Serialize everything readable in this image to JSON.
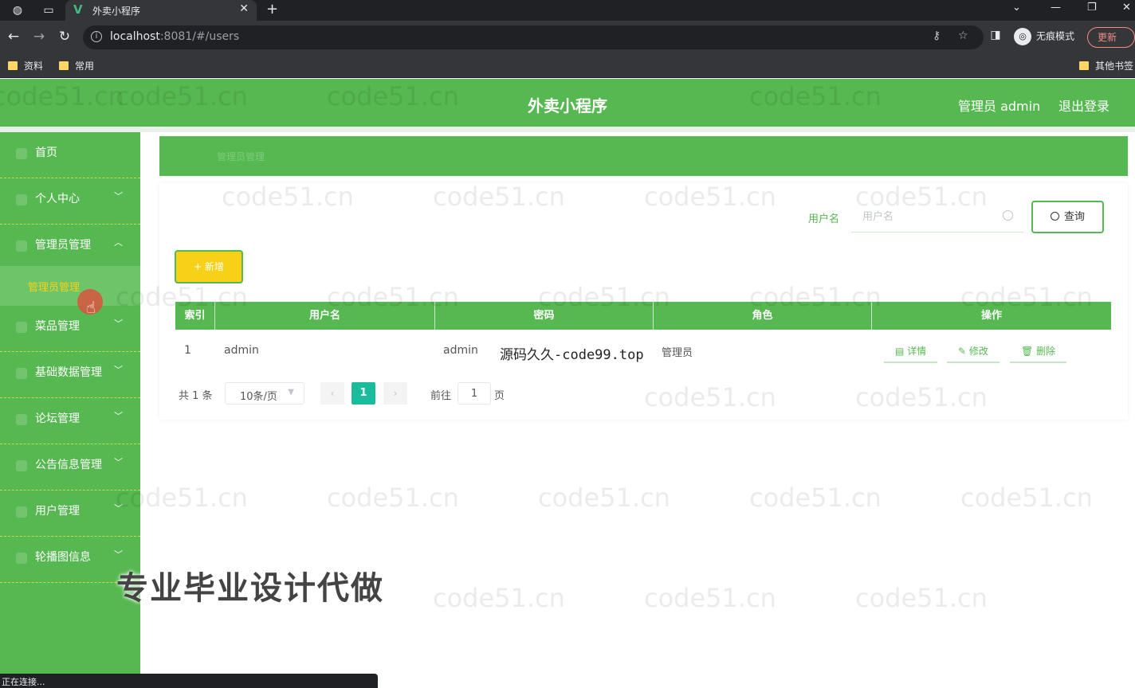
{
  "browser": {
    "tab_title": "外卖小程序",
    "tab_favicon": "V",
    "url_host": "localhost",
    "url_rest": ":8081/#/users",
    "incognito_label": "无痕模式",
    "update_label": "更新",
    "bookmarks": [
      "资料",
      "常用"
    ],
    "other_bookmarks": "其他书签",
    "status_text": "正在连接..."
  },
  "header": {
    "title": "外卖小程序",
    "user_label": "管理员 admin",
    "logout_label": "退出登录"
  },
  "sidebar": {
    "items": [
      {
        "label": "首页",
        "has_chevron": false
      },
      {
        "label": "个人中心",
        "has_chevron": true
      },
      {
        "label": "管理员管理",
        "has_chevron": true,
        "expanded": true
      },
      {
        "label": "菜品管理",
        "has_chevron": true
      },
      {
        "label": "基础数据管理",
        "has_chevron": true
      },
      {
        "label": "论坛管理",
        "has_chevron": true
      },
      {
        "label": "公告信息管理",
        "has_chevron": true
      },
      {
        "label": "用户管理",
        "has_chevron": true
      },
      {
        "label": "轮播图信息",
        "has_chevron": true
      }
    ],
    "active_sub": "管理员管理"
  },
  "breadcrumb": "管理员管理",
  "search": {
    "label": "用户名",
    "placeholder": "用户名",
    "button_label": "查询"
  },
  "add_button": "+ 新增",
  "table": {
    "headers": [
      "索引",
      "用户名",
      "密码",
      "角色",
      "操作"
    ],
    "rows": [
      {
        "index": "1",
        "username": "admin",
        "password": "admin",
        "role": "管理员"
      }
    ],
    "actions": {
      "detail": "详情",
      "edit": "修改",
      "delete": "删除"
    }
  },
  "pagination": {
    "total": "共 1 条",
    "page_size": "10条/页",
    "current_page": "1",
    "goto_label": "前往",
    "goto_value": "1",
    "unit": "页"
  },
  "overlays": {
    "watermark": "code51.cn",
    "site_text": "源码久久-code99.top",
    "ad_text": "专业毕业设计代做"
  },
  "colors": {
    "primary_green": "#56b850",
    "accent_yellow": "#f7d117",
    "page_active": "#1abc9c"
  }
}
